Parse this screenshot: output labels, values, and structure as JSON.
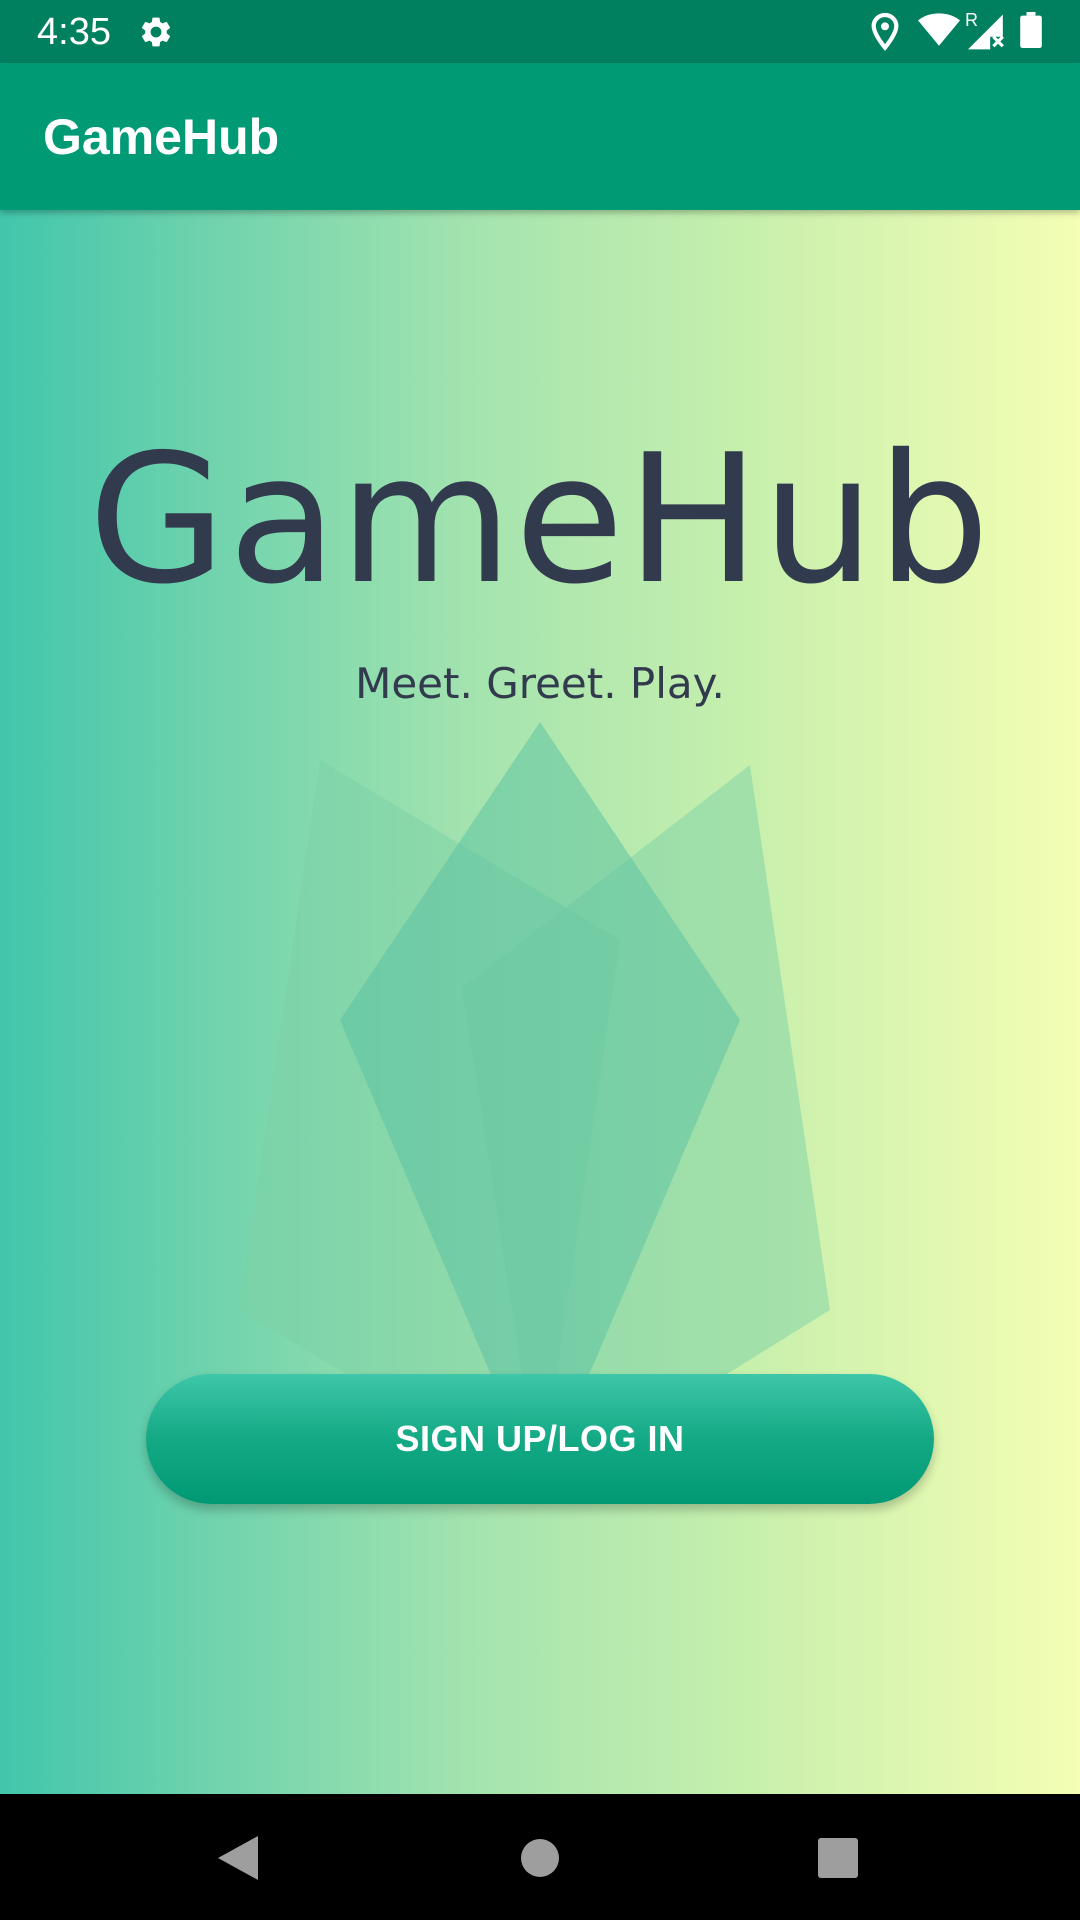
{
  "status_bar": {
    "time": "4:35",
    "icons": [
      "gear-icon",
      "location-icon",
      "wifi-icon",
      "signal-icon",
      "battery-icon"
    ],
    "roaming_indicator": "R"
  },
  "app_bar": {
    "title": "GameHub"
  },
  "main": {
    "hero_title": "GameHub",
    "tagline": "Meet. Greet. Play.",
    "sign_in_button_label": "SIGN UP/LOG IN"
  },
  "nav_bar": {
    "icons": [
      "back-icon",
      "home-icon",
      "recents-icon"
    ]
  },
  "colors": {
    "status_bar": "#00805f",
    "app_bar": "#009a74",
    "gradient_start": "#41c6ab",
    "gradient_end": "#f4feb4",
    "title_text": "#323a4d",
    "button": "#14a985"
  }
}
